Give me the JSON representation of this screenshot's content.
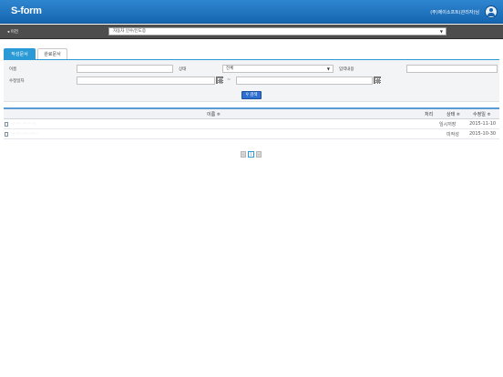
{
  "header": {
    "logo": "S-form",
    "user_label": "(주)에이소프트(관리자)님"
  },
  "nav": {
    "prev_label": "◂ 이전",
    "select_value": "자동차 인수/인도증"
  },
  "tabs": [
    {
      "label": "작성문서",
      "active": true
    },
    {
      "label": "완료문서",
      "active": false
    }
  ],
  "search": {
    "name_label": "이름",
    "name_value": "",
    "status_label": "상태",
    "status_value": "전체",
    "input_content_label": "입력내용",
    "input_content_value": "",
    "modified_date_label": "수정일자",
    "date_from": "",
    "date_to": "",
    "date_separator": "~",
    "search_button_label": "검색"
  },
  "table": {
    "columns": [
      "이름 ≑",
      "처리",
      "상태 ≑",
      "수정일 ≑"
    ],
    "rows": [
      {
        "name": "··· ···  ···  ·· ·:",
        "process": "",
        "status": "임시저장",
        "date": "2015-11-10"
      },
      {
        "name": "···  ··· ···· ···· ·",
        "process": "",
        "status": "미작성",
        "date": "2015-10-30"
      }
    ]
  },
  "pagination": {
    "prev": "‹",
    "current": "1",
    "next": "›"
  },
  "colors": {
    "header_blue": "#1f75c4",
    "tab_active": "#2a9ad6",
    "search_button": "#2f6fd0",
    "navbar": "#4d4d4d"
  }
}
